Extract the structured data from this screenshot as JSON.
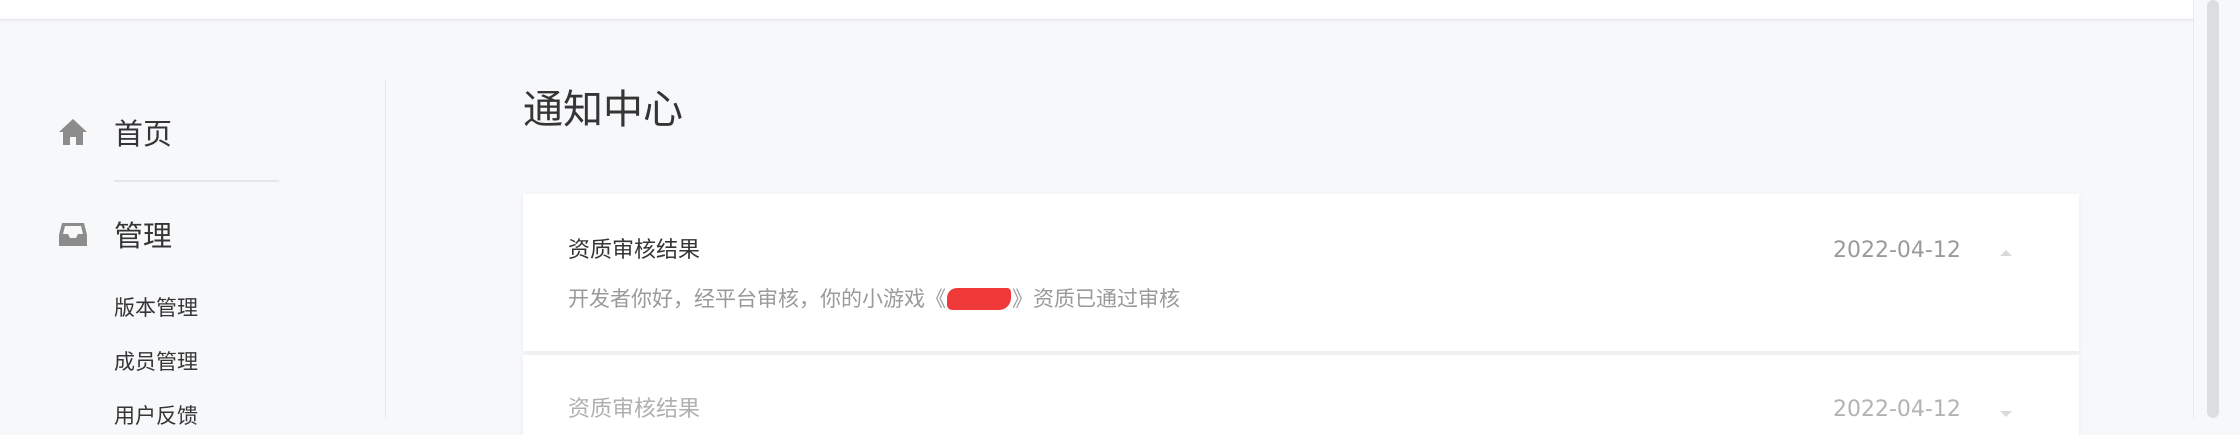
{
  "sidebar": {
    "home_label": "首页",
    "manage_label": "管理",
    "sub_items": [
      "版本管理",
      "成员管理",
      "用户反馈"
    ]
  },
  "main": {
    "title": "通知中心",
    "notifications": [
      {
        "title": "资质审核结果",
        "date": "2022-04-12",
        "body_prefix": "开发者你好，经平台审核，你的小游戏《",
        "body_suffix": "》资质已通过审核",
        "expanded": true
      },
      {
        "title": "资质审核结果",
        "date": "2022-04-12",
        "expanded": false
      }
    ]
  },
  "icons": {
    "home": "home-icon",
    "manage": "inbox-icon",
    "collapse": "chevron-up-icon",
    "expand": "chevron-down-icon"
  },
  "colors": {
    "icon": "#8c8c8c",
    "redaction": "#f03a3a",
    "muted_text": "#9a9a9a"
  }
}
